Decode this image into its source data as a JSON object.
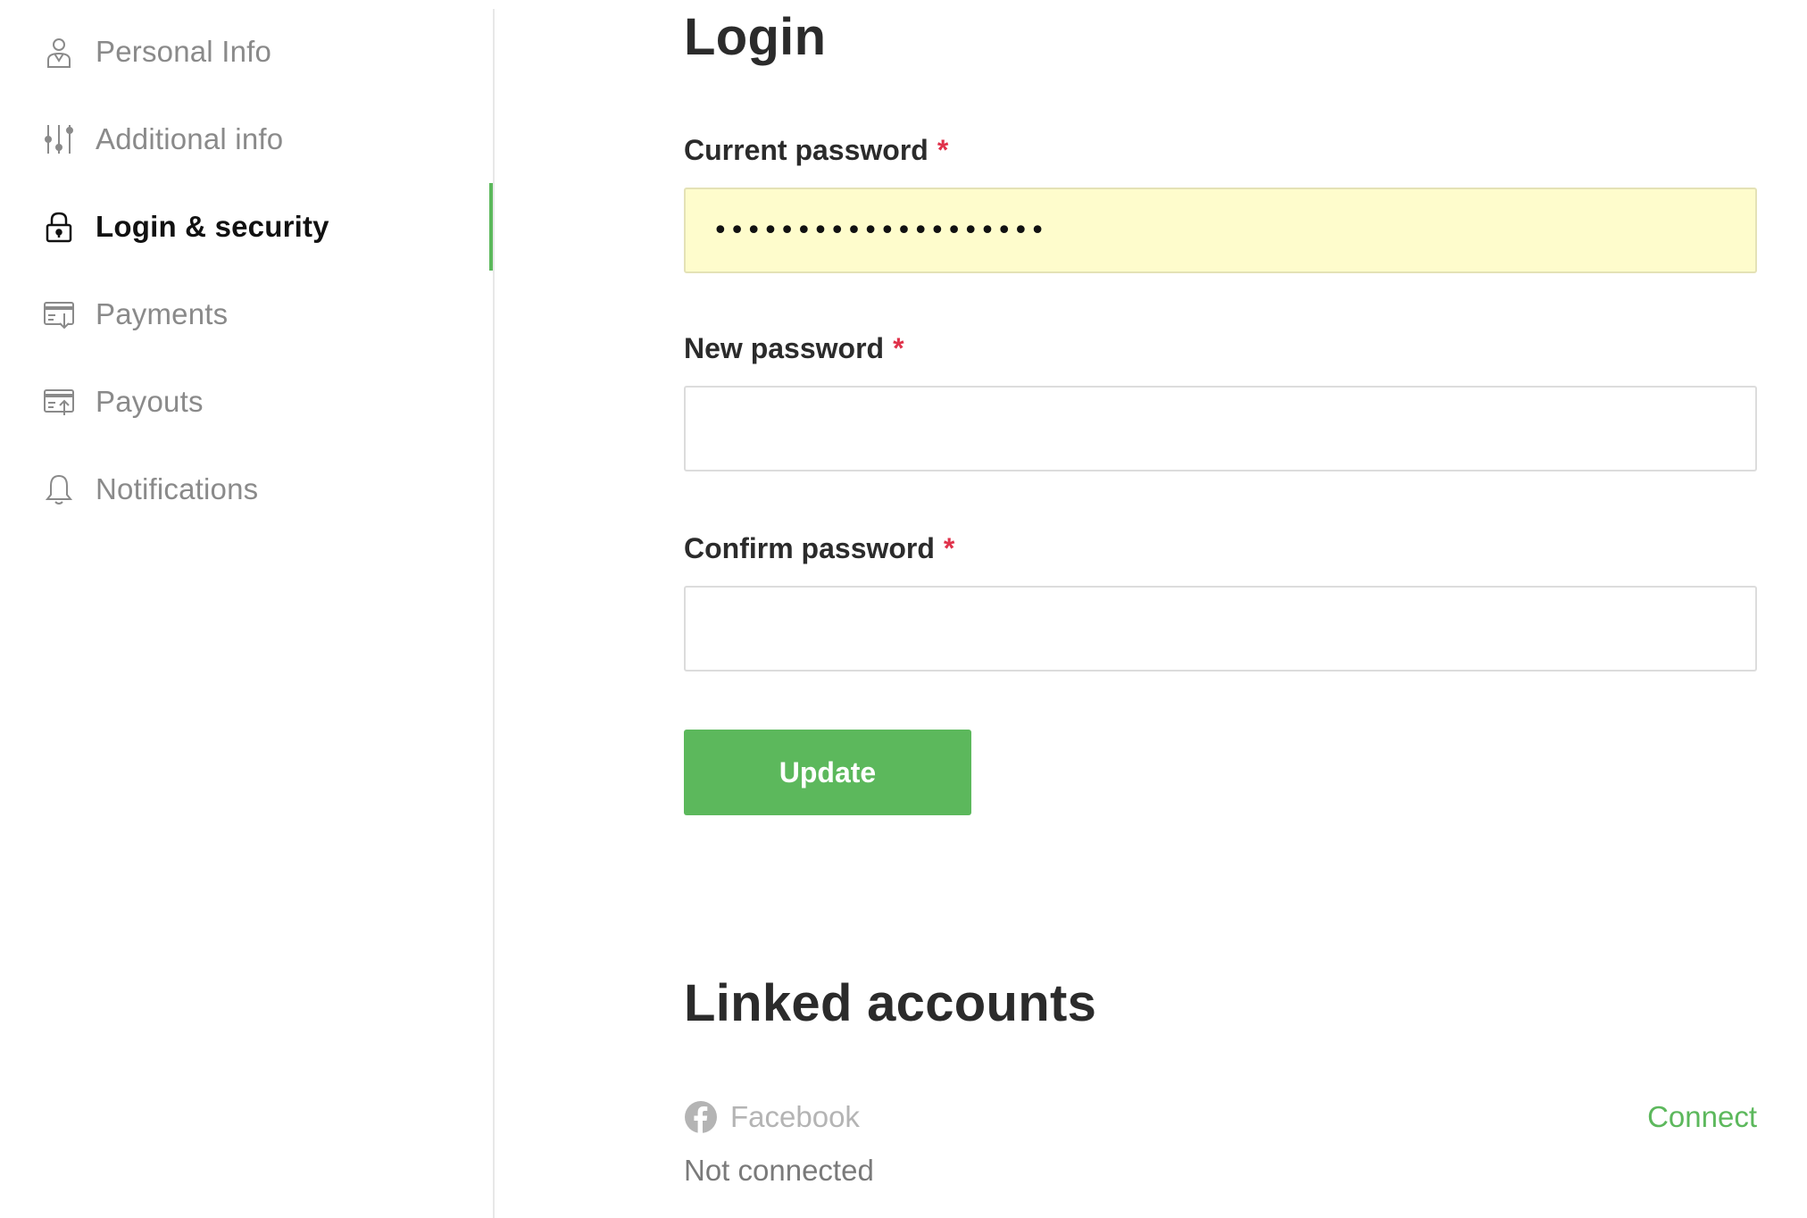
{
  "sidebar": {
    "items": [
      {
        "label": "Personal Info",
        "icon": "person-icon",
        "active": false
      },
      {
        "label": "Additional info",
        "icon": "sliders-icon",
        "active": false
      },
      {
        "label": "Login & security",
        "icon": "lock-icon",
        "active": true
      },
      {
        "label": "Payments",
        "icon": "card-download-icon",
        "active": false
      },
      {
        "label": "Payouts",
        "icon": "card-upload-icon",
        "active": false
      },
      {
        "label": "Notifications",
        "icon": "bell-icon",
        "active": false
      }
    ]
  },
  "login": {
    "title": "Login",
    "current_password": {
      "label": "Current password",
      "required_mark": "*",
      "value": "••••••••••••••••••••"
    },
    "new_password": {
      "label": "New password",
      "required_mark": "*",
      "value": ""
    },
    "confirm_password": {
      "label": "Confirm password",
      "required_mark": "*",
      "value": ""
    },
    "update_label": "Update"
  },
  "linked_accounts": {
    "title": "Linked accounts",
    "items": [
      {
        "name": "Facebook",
        "icon": "facebook-icon",
        "status": "Not connected",
        "action": "Connect"
      }
    ]
  },
  "colors": {
    "accent": "#5cb85c",
    "required": "#e0324b",
    "autofill": "#fefccc"
  }
}
